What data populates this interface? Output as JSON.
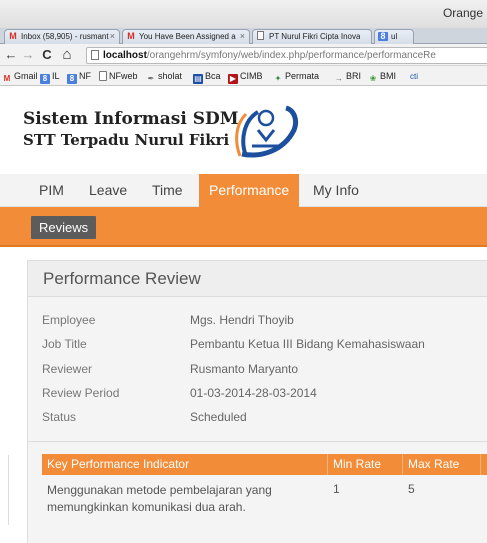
{
  "window": {
    "title": "Orange"
  },
  "tabs": [
    {
      "label": "Inbox (58,905) - rusmant",
      "icon": "gmail-icon"
    },
    {
      "label": "You Have Been Assigned a",
      "icon": "gmail-icon"
    },
    {
      "label": "PT Nurul Fikri Cipta Inova",
      "icon": "page-icon"
    },
    {
      "label": "ul",
      "icon": "google-icon"
    }
  ],
  "toolbar": {
    "back_glyph": "←",
    "forward_glyph": "→",
    "reload_glyph": "C",
    "home_glyph": "⌂",
    "url_host": "localhost",
    "url_path": "/orangehrm/symfony/web/index.php/performance/performanceRe"
  },
  "bookmarks": [
    {
      "label": "Gmail",
      "icon": "gmail-icon"
    },
    {
      "label": "IL",
      "icon": "google-icon"
    },
    {
      "label": "NF",
      "icon": "google-icon"
    },
    {
      "label": "NFweb",
      "icon": "page-icon"
    },
    {
      "label": "sholat",
      "icon": "feather-icon"
    },
    {
      "label": "Bca",
      "icon": "bank-icon"
    },
    {
      "label": "CIMB",
      "icon": "cimb-icon"
    },
    {
      "label": "Permata",
      "icon": "star-icon"
    },
    {
      "label": "BRI",
      "icon": "arrow-icon"
    },
    {
      "label": "BMI",
      "icon": "leaf-icon"
    },
    {
      "label": "cti",
      "icon": "citi-icon"
    }
  ],
  "header": {
    "title": "Sistem Informasi SDM",
    "subtitle": "STT Terpadu Nurul Fikri"
  },
  "menu": {
    "items": [
      {
        "label": "PIM",
        "active": false
      },
      {
        "label": "Leave",
        "active": false
      },
      {
        "label": "Time",
        "active": false
      },
      {
        "label": "Performance",
        "active": true
      },
      {
        "label": "My Info",
        "active": false
      }
    ],
    "sub_button": "Reviews"
  },
  "review": {
    "title": "Performance Review",
    "fields": [
      {
        "label": "Employee",
        "value": "Mgs. Hendri Thoyib"
      },
      {
        "label": "Job Title",
        "value": "Pembantu Ketua III Bidang Kemahasiswaan"
      },
      {
        "label": "Reviewer",
        "value": "Rusmanto Maryanto"
      },
      {
        "label": "Review Period",
        "value": "01-03-2014-28-03-2014"
      },
      {
        "label": "Status",
        "value": "Scheduled"
      }
    ],
    "kpi": {
      "headers": {
        "kpi": "Key Performance Indicator",
        "min": "Min Rate",
        "max": "Max Rate"
      },
      "rows": [
        {
          "kpi": "Menggunakan metode pembelajaran yang memungkinkan komunikasi dua arah.",
          "min": "1",
          "max": "5"
        }
      ]
    }
  },
  "colors": {
    "accent": "#f28c38",
    "dark_button": "#5c5c5c"
  }
}
